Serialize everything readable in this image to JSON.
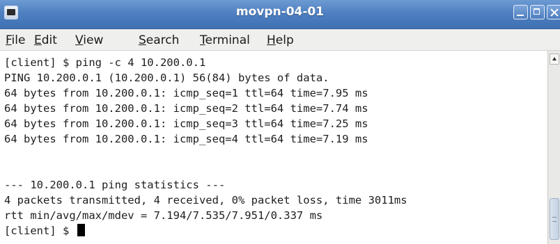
{
  "window": {
    "title": "movpn-04-01"
  },
  "menubar": {
    "items": [
      {
        "mnemonic": "F",
        "rest": "ile"
      },
      {
        "mnemonic": "E",
        "rest": "dit"
      },
      {
        "mnemonic": "V",
        "rest": "iew"
      },
      {
        "mnemonic": "S",
        "rest": "earch"
      },
      {
        "mnemonic": "T",
        "rest": "erminal"
      },
      {
        "mnemonic": "H",
        "rest": "elp"
      }
    ]
  },
  "terminal": {
    "lines": [
      "[client] $ ping -c 4 10.200.0.1",
      "PING 10.200.0.1 (10.200.0.1) 56(84) bytes of data.",
      "64 bytes from 10.200.0.1: icmp_seq=1 ttl=64 time=7.95 ms",
      "64 bytes from 10.200.0.1: icmp_seq=2 ttl=64 time=7.74 ms",
      "64 bytes from 10.200.0.1: icmp_seq=3 ttl=64 time=7.25 ms",
      "64 bytes from 10.200.0.1: icmp_seq=4 ttl=64 time=7.19 ms",
      "",
      "--- 10.200.0.1 ping statistics ---",
      "4 packets transmitted, 4 received, 0% packet loss, time 3011ms",
      "rtt min/avg/max/mdev = 7.194/7.535/7.951/0.337 ms"
    ],
    "prompt": "[client] $ "
  },
  "icons": {
    "app": "terminal-icon",
    "minimize": "minimize-icon",
    "maximize": "maximize-icon",
    "close": "close-icon",
    "scroll_up": "chevron-up-icon"
  },
  "colors": {
    "titlebar": "#4f80c1",
    "menubar": "#efefed",
    "terminal_bg": "#ffffff",
    "terminal_fg": "#1e1e1e"
  }
}
